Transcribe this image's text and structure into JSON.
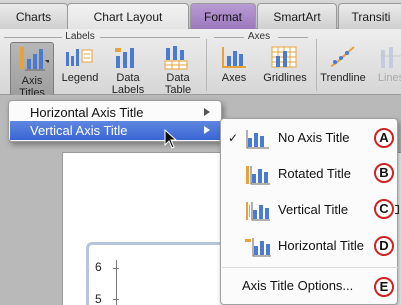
{
  "tabs": [
    "Charts",
    "Chart Layout",
    "Format",
    "SmartArt",
    "Transiti"
  ],
  "ribbon": {
    "groups": {
      "labels": "Labels",
      "axes": "Axes"
    },
    "buttons": {
      "axis_titles": "Axis\nTitles",
      "legend": "Legend",
      "data_labels": "Data\nLabels",
      "data_table": "Data\nTable",
      "axes": "Axes",
      "gridlines": "Gridlines",
      "trendline": "Trendline",
      "lines": "Lines"
    }
  },
  "menu": {
    "items": [
      "Horizontal Axis Title",
      "Vertical Axis Title"
    ]
  },
  "submenu": {
    "items": [
      "No Axis Title",
      "Rotated Title",
      "Vertical Title",
      "Horizontal Title"
    ],
    "options": "Axis Title Options...",
    "checked_mark": "✓"
  },
  "markers": [
    "A",
    "B",
    "C",
    "D",
    "E"
  ],
  "chart": {
    "y_ticks": [
      "6",
      "5"
    ]
  },
  "colors": {
    "highlight": "#3a66d4",
    "marker": "#d22222",
    "active_tab": "#9b78bd"
  }
}
